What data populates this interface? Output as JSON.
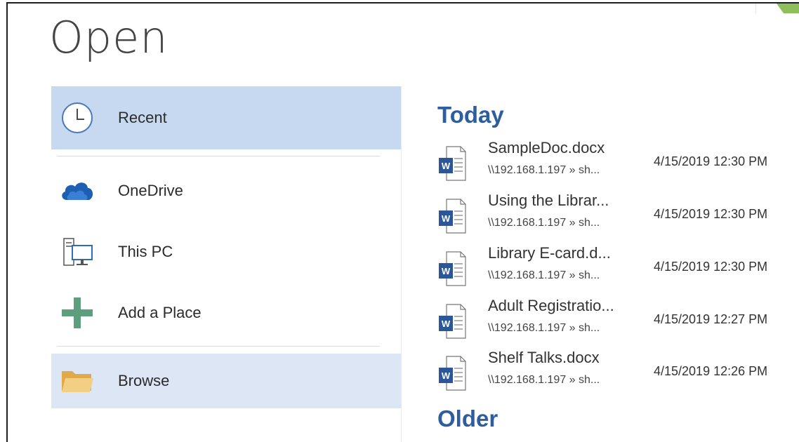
{
  "title": "Open",
  "places": {
    "recent": "Recent",
    "onedrive": "OneDrive",
    "this_pc": "This PC",
    "add_place": "Add a Place",
    "browse": "Browse"
  },
  "sections": {
    "today": "Today",
    "older": "Older"
  },
  "files": [
    {
      "name": "SampleDoc.docx",
      "path": "\\\\192.168.1.197 » sh...",
      "date": "4/15/2019 12:30 PM"
    },
    {
      "name": "Using the Librar...",
      "path": "\\\\192.168.1.197 » sh...",
      "date": "4/15/2019 12:30 PM"
    },
    {
      "name": "Library E-card.d...",
      "path": "\\\\192.168.1.197 » sh...",
      "date": "4/15/2019 12:30 PM"
    },
    {
      "name": "Adult Registratio...",
      "path": "\\\\192.168.1.197 » sh...",
      "date": "4/15/2019 12:27 PM"
    },
    {
      "name": "Shelf Talks.docx",
      "path": "\\\\192.168.1.197 » sh...",
      "date": "4/15/2019 12:26 PM"
    }
  ],
  "colors": {
    "selected_bg": "#c7d9f1",
    "browse_bg": "#dde6f5",
    "section_heading": "#2e5e9e",
    "word_blue": "#2b579a",
    "onedrive_blue": "#1e5fb3",
    "add_green": "#5d9e7c",
    "folder_yellow": "#f0c36d"
  },
  "icons": {
    "recent": "clock-icon",
    "onedrive": "cloud-icon",
    "this_pc": "computer-icon",
    "add_place": "plus-icon",
    "browse": "folder-icon",
    "file": "word-document-icon"
  }
}
